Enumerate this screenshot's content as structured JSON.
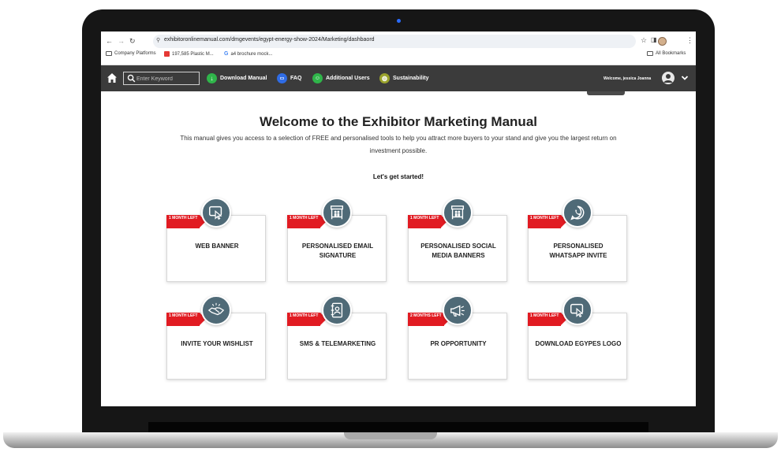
{
  "browser": {
    "url": "exhibitoronlinemanual.com/dmgevents/egypt-energy-show-2024/Marketing/dashbaord",
    "bookmarks": [
      {
        "label": "Company Platforms",
        "icon": "folder-icon"
      },
      {
        "label": "197,585 Plastic M...",
        "icon": "red-favicon"
      },
      {
        "label": "a4 brochure mock...",
        "icon": "google-favicon"
      }
    ],
    "all_bookmarks_label": "All Bookmarks"
  },
  "navbar": {
    "search_placeholder": "Enter Keyword",
    "items": [
      {
        "label": "Download Manual",
        "icon": "download-icon",
        "color": "#2fb54a"
      },
      {
        "label": "FAQ",
        "icon": "chat-icon",
        "color": "#2f6ce5"
      },
      {
        "label": "Additional Users",
        "icon": "users-icon",
        "color": "#2fb54a"
      },
      {
        "label": "Sustainability",
        "icon": "globe-icon",
        "color": "#9aa32c"
      }
    ],
    "welcome": "Welcome, jessica Joanna"
  },
  "main": {
    "title": "Welcome to the Exhibitor Marketing Manual",
    "intro": "This manual gives you access to a selection of FREE and personalised tools to help you attract more buyers to your stand and give you the largest return on investment possible.",
    "started": "Let's get started!"
  },
  "cards": [
    {
      "label": "WEB BANNER",
      "ribbon": "1 MONTH LEFT",
      "icon": "web-banner-icon"
    },
    {
      "label": "PERSONALISED EMAIL SIGNATURE",
      "ribbon": "1 MONTH LEFT",
      "icon": "booth-icon"
    },
    {
      "label": "PERSONALISED SOCIAL MEDIA BANNERS",
      "ribbon": "1 MONTH LEFT",
      "icon": "booth-icon"
    },
    {
      "label": "PERSONALISED WHATSAPP INVITE",
      "ribbon": "1 MONTH LEFT",
      "icon": "whatsapp-icon"
    },
    {
      "label": "INVITE YOUR WISHLIST",
      "ribbon": "1 MONTH LEFT",
      "icon": "handshake-icon"
    },
    {
      "label": "SMS & TELEMARKETING",
      "ribbon": "1 MONTH LEFT",
      "icon": "contacts-icon"
    },
    {
      "label": "PR OPPORTUNITY",
      "ribbon": "2 MONTHS LEFT",
      "icon": "megaphone-icon"
    },
    {
      "label": "DOWNLOAD EGYPES LOGO",
      "ribbon": "1 MONTH LEFT",
      "icon": "click-icon"
    }
  ],
  "theme": {
    "navbar_bg": "#3b3b3b",
    "ribbon": "#e11b22",
    "icon_bg": "#4f6a77"
  }
}
